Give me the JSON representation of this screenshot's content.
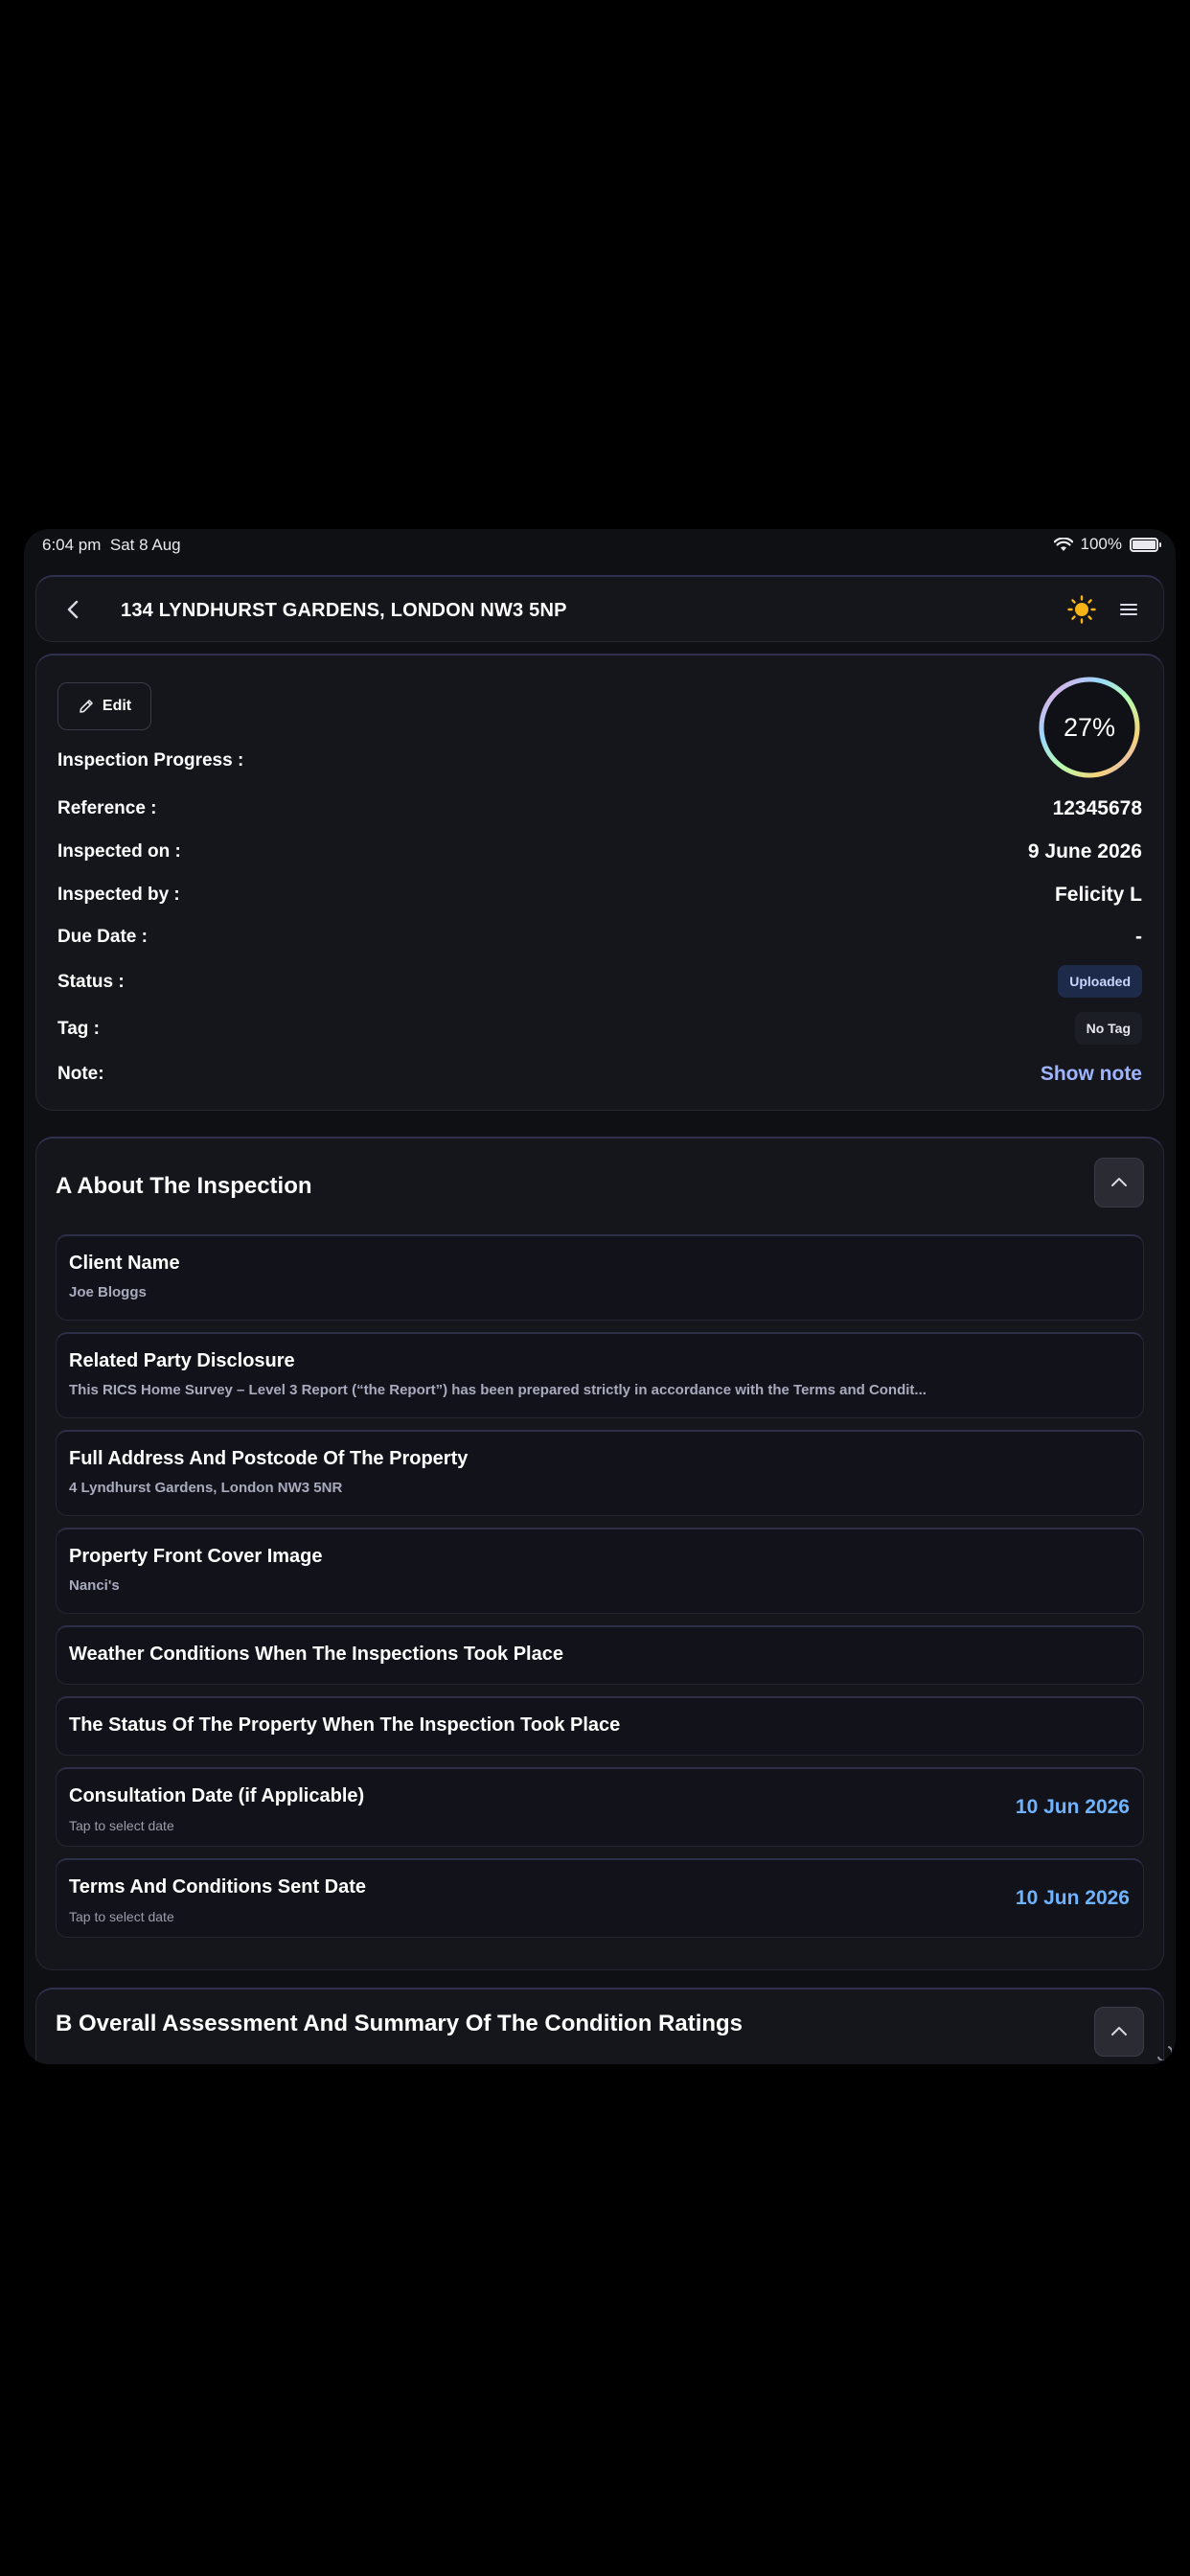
{
  "status_bar": {
    "time": "6:04 pm",
    "date": "Sat 8 Aug",
    "battery": "100%"
  },
  "header": {
    "title": "134 LYNDHURST GARDENS, LONDON NW3 5NP"
  },
  "info": {
    "edit_label": "Edit",
    "progress": {
      "label": "Inspection Progress :",
      "value_text": "27%",
      "value": 27
    },
    "rows": {
      "reference": {
        "label": "Reference :",
        "value": "12345678"
      },
      "inspected_on": {
        "label": "Inspected on :",
        "value": "9 June 2026"
      },
      "inspected_by": {
        "label": "Inspected by :",
        "value": "Felicity L"
      },
      "due_date": {
        "label": "Due Date :",
        "value": "-"
      },
      "status": {
        "label": "Status :",
        "value": "Uploaded"
      },
      "tag": {
        "label": "Tag :",
        "value": "No Tag"
      },
      "note": {
        "label": "Note:",
        "value": "Show note"
      }
    }
  },
  "section_a": {
    "title": "A About The Inspection",
    "fields": {
      "client_name": {
        "title": "Client Name",
        "value": "Joe Bloggs"
      },
      "related_party": {
        "title": "Related Party Disclosure",
        "value": "This RICS Home Survey – Level 3 Report (“the Report”) has been prepared strictly in accordance with the Terms and Condit..."
      },
      "address": {
        "title": "Full Address And Postcode Of The Property",
        "value": "4 Lyndhurst Gardens, London NW3 5NR"
      },
      "cover_image": {
        "title": "Property Front Cover Image",
        "value": "Nanci's"
      },
      "weather": {
        "title": "Weather Conditions When The Inspections Took Place"
      },
      "property_status": {
        "title": "The Status Of The Property When The Inspection Took Place"
      },
      "consultation_date": {
        "title": "Consultation Date (if Applicable)",
        "hint": "Tap to select date",
        "date": "10 Jun 2026"
      },
      "terms_date": {
        "title": "Terms And Conditions Sent Date",
        "hint": "Tap to select date",
        "date": "10 Jun 2026"
      }
    }
  },
  "section_b": {
    "title": "B Overall Assessment And Summary Of The Condition Ratings"
  },
  "colors": {
    "accent": "#6fb3ff",
    "link": "#9fb4ff",
    "sun": "#f5b316",
    "background": "#0f1014"
  },
  "icons": [
    "back-chevron-icon",
    "sun-icon",
    "menu-icon",
    "pencil-icon",
    "chevron-up-icon",
    "wifi-icon",
    "battery-icon",
    "loader-icon"
  ]
}
